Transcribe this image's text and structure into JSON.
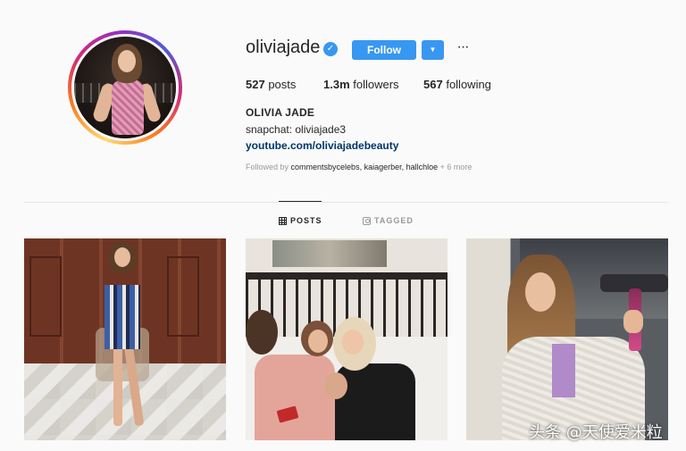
{
  "profile": {
    "username": "oliviajade",
    "verified": true,
    "follow_label": "Follow",
    "dropdown_glyph": "▼",
    "more_glyph": "···",
    "stats": {
      "posts_count": "527",
      "posts_label": "posts",
      "followers_count": "1.3m",
      "followers_label": "followers",
      "following_count": "567",
      "following_label": "following"
    },
    "full_name": "OLIVIA JADE",
    "bio": "snapchat: oliviajade3",
    "website": "youtube.com/oliviajadebeauty",
    "followed_by": {
      "prefix": "Followed by ",
      "names": "commentsbycelebs, kaiagerber, hallchloe",
      "suffix": " + 6 more"
    }
  },
  "tabs": [
    {
      "label": "POSTS",
      "icon": "grid-icon",
      "active": true
    },
    {
      "label": "TAGGED",
      "icon": "tag-icon",
      "active": false
    }
  ],
  "posts": [
    {
      "alt": "post 1"
    },
    {
      "alt": "post 2"
    },
    {
      "alt": "post 3"
    }
  ],
  "watermark": "头条 @天使爱米粒",
  "colors": {
    "accent": "#3897f0",
    "link": "#003569",
    "muted": "#999999",
    "text": "#262626",
    "background": "#fafafa"
  }
}
